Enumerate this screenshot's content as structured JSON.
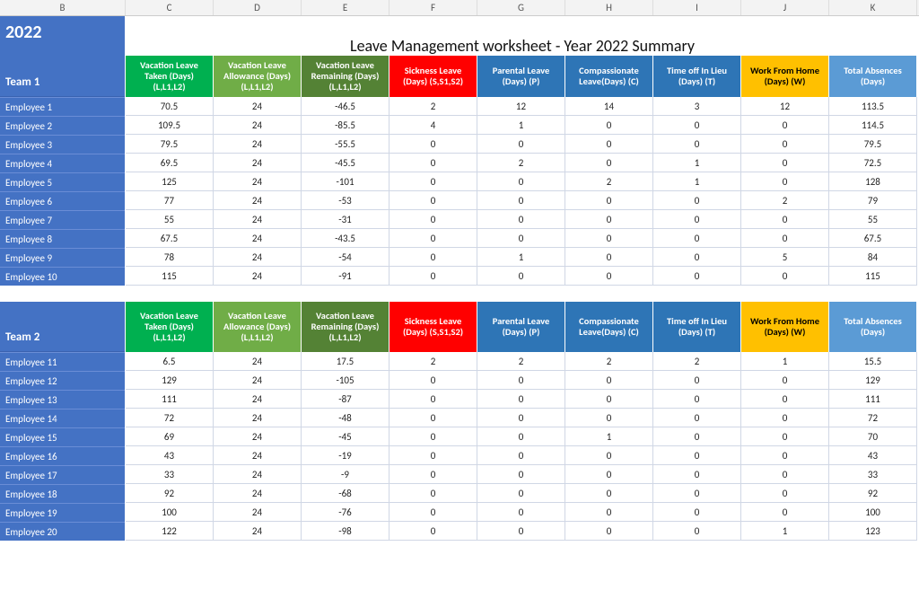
{
  "columns_letters": [
    "B",
    "C",
    "D",
    "E",
    "F",
    "G",
    "H",
    "I",
    "J",
    "K"
  ],
  "page_title": "Leave Management worksheet - Year 2022 Summary",
  "year_label": "2022",
  "headers": [
    {
      "key": "vac_taken",
      "label": "Vacation Leave Taken (Days) (L,L1,L2)",
      "cls": "green1"
    },
    {
      "key": "vac_allow",
      "label": "Vacation Leave Allowance (Days) (L,L1,L2)",
      "cls": "green2"
    },
    {
      "key": "vac_rem",
      "label": "Vacation Leave Remaining (Days) (L,L1,L2)",
      "cls": "green3"
    },
    {
      "key": "sick",
      "label": "Sickness Leave (Days) (S,S1,S2)",
      "cls": "red"
    },
    {
      "key": "parental",
      "label": "Parental Leave (Days) (P)",
      "cls": "blue1"
    },
    {
      "key": "compassion",
      "label": "Compassionate Leave(Days) (C)",
      "cls": "blue2"
    },
    {
      "key": "toil",
      "label": "Time off In Lieu (Days) (T)",
      "cls": "blue3"
    },
    {
      "key": "wfh",
      "label": "Work From Home (Days) (W)",
      "cls": "gold"
    },
    {
      "key": "total",
      "label": "Total Absences (Days)",
      "cls": "tblue"
    }
  ],
  "teams": [
    {
      "name": "Team 1",
      "show_year": true,
      "rows": [
        {
          "emp": "Employee 1",
          "vals": [
            "70.5",
            "24",
            "-46.5",
            "2",
            "12",
            "14",
            "3",
            "12",
            "113.5"
          ]
        },
        {
          "emp": "Employee 2",
          "vals": [
            "109.5",
            "24",
            "-85.5",
            "4",
            "1",
            "0",
            "0",
            "0",
            "114.5"
          ]
        },
        {
          "emp": "Employee 3",
          "vals": [
            "79.5",
            "24",
            "-55.5",
            "0",
            "0",
            "0",
            "0",
            "0",
            "79.5"
          ]
        },
        {
          "emp": "Employee 4",
          "vals": [
            "69.5",
            "24",
            "-45.5",
            "0",
            "2",
            "0",
            "1",
            "0",
            "72.5"
          ]
        },
        {
          "emp": "Employee 5",
          "vals": [
            "125",
            "24",
            "-101",
            "0",
            "0",
            "2",
            "1",
            "0",
            "128"
          ]
        },
        {
          "emp": "Employee 6",
          "vals": [
            "77",
            "24",
            "-53",
            "0",
            "0",
            "0",
            "0",
            "2",
            "79"
          ]
        },
        {
          "emp": "Employee 7",
          "vals": [
            "55",
            "24",
            "-31",
            "0",
            "0",
            "0",
            "0",
            "0",
            "55"
          ]
        },
        {
          "emp": "Employee 8",
          "vals": [
            "67.5",
            "24",
            "-43.5",
            "0",
            "0",
            "0",
            "0",
            "0",
            "67.5"
          ]
        },
        {
          "emp": "Employee 9",
          "vals": [
            "78",
            "24",
            "-54",
            "0",
            "1",
            "0",
            "0",
            "5",
            "84"
          ]
        },
        {
          "emp": "Employee 10",
          "vals": [
            "115",
            "24",
            "-91",
            "0",
            "0",
            "0",
            "0",
            "0",
            "115"
          ]
        }
      ]
    },
    {
      "name": "Team 2",
      "show_year": false,
      "rows": [
        {
          "emp": "Employee 11",
          "vals": [
            "6.5",
            "24",
            "17.5",
            "2",
            "2",
            "2",
            "2",
            "1",
            "15.5"
          ]
        },
        {
          "emp": "Employee 12",
          "vals": [
            "129",
            "24",
            "-105",
            "0",
            "0",
            "0",
            "0",
            "0",
            "129"
          ]
        },
        {
          "emp": "Employee 13",
          "vals": [
            "111",
            "24",
            "-87",
            "0",
            "0",
            "0",
            "0",
            "0",
            "111"
          ]
        },
        {
          "emp": "Employee 14",
          "vals": [
            "72",
            "24",
            "-48",
            "0",
            "0",
            "0",
            "0",
            "0",
            "72"
          ]
        },
        {
          "emp": "Employee 15",
          "vals": [
            "69",
            "24",
            "-45",
            "0",
            "0",
            "1",
            "0",
            "0",
            "70"
          ]
        },
        {
          "emp": "Employee 16",
          "vals": [
            "43",
            "24",
            "-19",
            "0",
            "0",
            "0",
            "0",
            "0",
            "43"
          ]
        },
        {
          "emp": "Employee 17",
          "vals": [
            "33",
            "24",
            "-9",
            "0",
            "0",
            "0",
            "0",
            "0",
            "33"
          ]
        },
        {
          "emp": "Employee 18",
          "vals": [
            "92",
            "24",
            "-68",
            "0",
            "0",
            "0",
            "0",
            "0",
            "92"
          ]
        },
        {
          "emp": "Employee 19",
          "vals": [
            "100",
            "24",
            "-76",
            "0",
            "0",
            "0",
            "0",
            "0",
            "100"
          ]
        },
        {
          "emp": "Employee 20",
          "vals": [
            "122",
            "24",
            "-98",
            "0",
            "0",
            "0",
            "0",
            "1",
            "123"
          ]
        }
      ]
    }
  ],
  "chart_data": {
    "type": "table",
    "title": "Leave Management worksheet - Year 2022 Summary",
    "columns": [
      "Team",
      "Employee",
      "Vacation Leave Taken (Days)",
      "Vacation Leave Allowance (Days)",
      "Vacation Leave Remaining (Days)",
      "Sickness Leave (Days)",
      "Parental Leave (Days)",
      "Compassionate Leave (Days)",
      "Time off In Lieu (Days)",
      "Work From Home (Days)",
      "Total Absences (Days)"
    ],
    "rows": [
      [
        "Team 1",
        "Employee 1",
        70.5,
        24,
        -46.5,
        2,
        12,
        14,
        3,
        12,
        113.5
      ],
      [
        "Team 1",
        "Employee 2",
        109.5,
        24,
        -85.5,
        4,
        1,
        0,
        0,
        0,
        114.5
      ],
      [
        "Team 1",
        "Employee 3",
        79.5,
        24,
        -55.5,
        0,
        0,
        0,
        0,
        0,
        79.5
      ],
      [
        "Team 1",
        "Employee 4",
        69.5,
        24,
        -45.5,
        0,
        2,
        0,
        1,
        0,
        72.5
      ],
      [
        "Team 1",
        "Employee 5",
        125,
        24,
        -101,
        0,
        0,
        2,
        1,
        0,
        128
      ],
      [
        "Team 1",
        "Employee 6",
        77,
        24,
        -53,
        0,
        0,
        0,
        0,
        2,
        79
      ],
      [
        "Team 1",
        "Employee 7",
        55,
        24,
        -31,
        0,
        0,
        0,
        0,
        0,
        55
      ],
      [
        "Team 1",
        "Employee 8",
        67.5,
        24,
        -43.5,
        0,
        0,
        0,
        0,
        0,
        67.5
      ],
      [
        "Team 1",
        "Employee 9",
        78,
        24,
        -54,
        0,
        1,
        0,
        0,
        5,
        84
      ],
      [
        "Team 1",
        "Employee 10",
        115,
        24,
        -91,
        0,
        0,
        0,
        0,
        0,
        115
      ],
      [
        "Team 2",
        "Employee 11",
        6.5,
        24,
        17.5,
        2,
        2,
        2,
        2,
        1,
        15.5
      ],
      [
        "Team 2",
        "Employee 12",
        129,
        24,
        -105,
        0,
        0,
        0,
        0,
        0,
        129
      ],
      [
        "Team 2",
        "Employee 13",
        111,
        24,
        -87,
        0,
        0,
        0,
        0,
        0,
        111
      ],
      [
        "Team 2",
        "Employee 14",
        72,
        24,
        -48,
        0,
        0,
        0,
        0,
        0,
        72
      ],
      [
        "Team 2",
        "Employee 15",
        69,
        24,
        -45,
        0,
        0,
        1,
        0,
        0,
        70
      ],
      [
        "Team 2",
        "Employee 16",
        43,
        24,
        -19,
        0,
        0,
        0,
        0,
        0,
        43
      ],
      [
        "Team 2",
        "Employee 17",
        33,
        24,
        -9,
        0,
        0,
        0,
        0,
        0,
        33
      ],
      [
        "Team 2",
        "Employee 18",
        92,
        24,
        -68,
        0,
        0,
        0,
        0,
        0,
        92
      ],
      [
        "Team 2",
        "Employee 19",
        100,
        24,
        -76,
        0,
        0,
        0,
        0,
        0,
        100
      ],
      [
        "Team 2",
        "Employee 20",
        122,
        24,
        -98,
        0,
        0,
        0,
        0,
        1,
        123
      ]
    ]
  }
}
